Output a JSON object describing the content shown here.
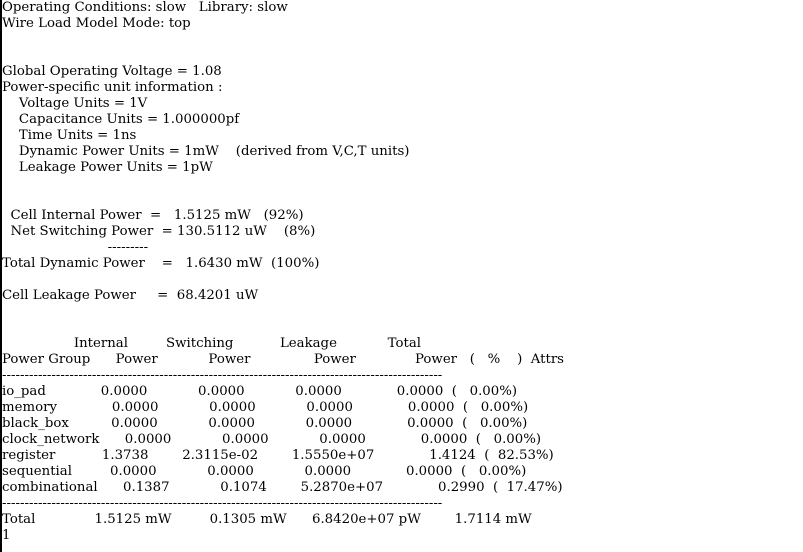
{
  "report": {
    "header": {
      "operating_conditions": "Operating Conditions: slow   Library: slow",
      "wire_load_model_mode": "Wire Load Model Mode: top"
    },
    "units": {
      "global_voltage": "Global Operating Voltage = 1.08",
      "power_unit_info": "Power-specific unit information :",
      "voltage_units": "    Voltage Units = 1V",
      "capacitance_units": "    Capacitance Units = 1.000000pf",
      "time_units": "    Time Units = 1ns",
      "dynamic_power_units": "    Dynamic Power Units = 1mW    (derived from V,C,T units)",
      "leakage_power_units": "    Leakage Power Units = 1pW"
    },
    "summary": {
      "cell_internal_power": "  Cell Internal Power  =   1.5125 mW   (92%)",
      "net_switching_power": "  Net Switching Power  = 130.5112 uW    (8%)",
      "dashes": "                         ---------",
      "total_dynamic_power": "Total Dynamic Power    =   1.6430 mW  (100%)",
      "cell_leakage_power": "Cell Leakage Power     =  68.4201 uW"
    },
    "table": {
      "header_line1": "                 Internal         Switching           Leakage            Total",
      "header_line2": "Power Group      Power            Power               Power              Power   (   %    )  Attrs",
      "separator": "--------------------------------------------------------------------------------------------------",
      "rows": [
        "io_pad             0.0000            0.0000            0.0000             0.0000  (   0.00%)",
        "memory             0.0000            0.0000            0.0000             0.0000  (   0.00%)",
        "black_box          0.0000            0.0000            0.0000             0.0000  (   0.00%)",
        "clock_network      0.0000            0.0000            0.0000             0.0000  (   0.00%)",
        "register           1.3738        2.3115e-02        1.5550e+07             1.4124  (  82.53%)",
        "sequential         0.0000            0.0000            0.0000             0.0000  (   0.00%)",
        "combinational      0.1387            0.1074        5.2870e+07             0.2990  (  17.47%)"
      ],
      "total": "Total              1.5125 mW         0.1305 mW      6.8420e+07 pW        1.7114 mW"
    },
    "footer": {
      "result": "1"
    }
  }
}
